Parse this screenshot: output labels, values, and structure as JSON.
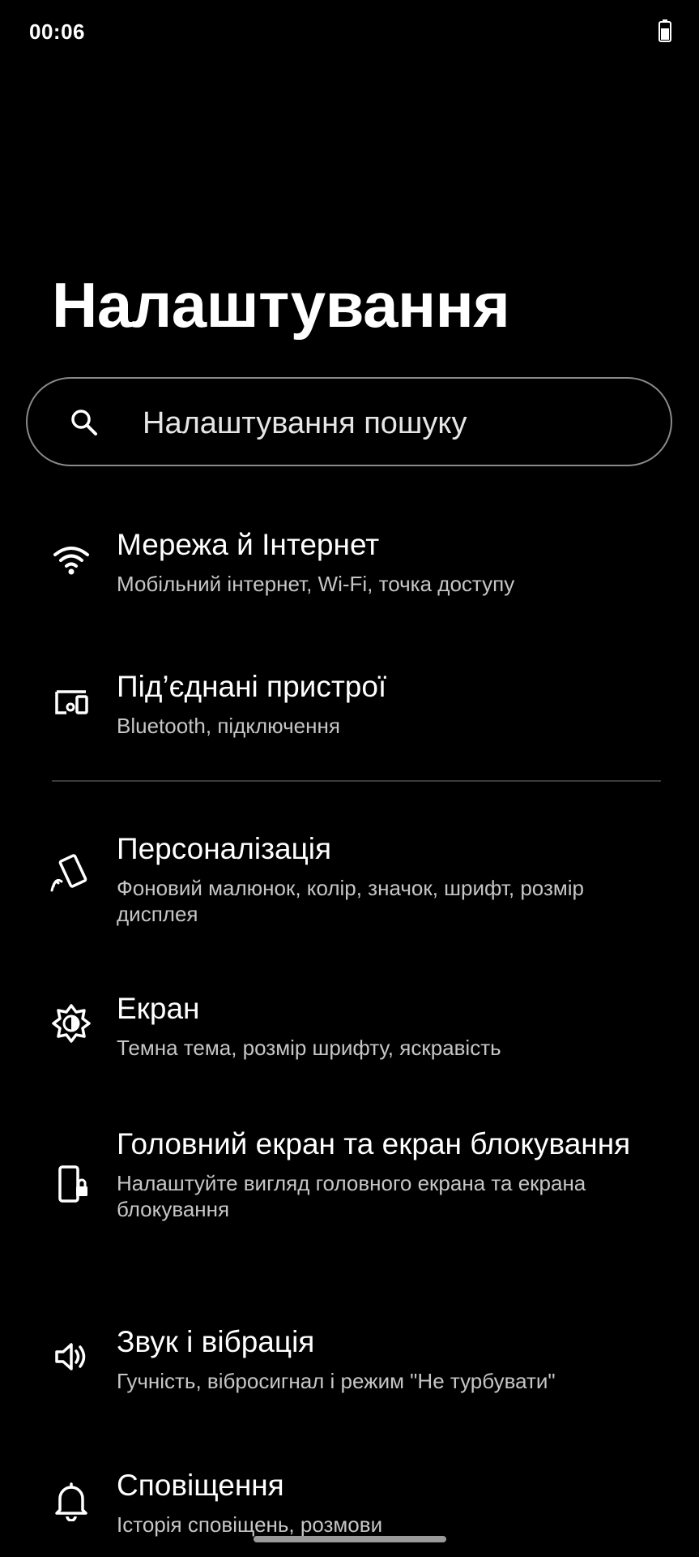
{
  "status_bar": {
    "time": "00:06",
    "battery_icon": "battery-icon"
  },
  "header": {
    "title": "Налаштування"
  },
  "search": {
    "placeholder": "Налаштування пошуку",
    "icon": "search-icon"
  },
  "items": [
    {
      "icon": "wifi-icon",
      "title": "Мережа й Інтернет",
      "subtitle": "Мобільний інтернет, Wi-Fi, точка доступу"
    },
    {
      "icon": "connected-devices-icon",
      "title": "Під’єднані пристрої",
      "subtitle": "Bluetooth, підключення"
    },
    {
      "icon": "personalization-icon",
      "title": "Персоналізація",
      "subtitle": "Фоновий малюнок, колір, значок, шрифт, розмір дисплея"
    },
    {
      "icon": "display-brightness-icon",
      "title": "Екран",
      "subtitle": "Темна тема, розмір шрифту, яскравість"
    },
    {
      "icon": "lock-screen-icon",
      "title": "Головний екран та екран блокування",
      "subtitle": "Налаштуйте вигляд головного екрана та екрана блокування"
    },
    {
      "icon": "sound-icon",
      "title": "Звук і вібрація",
      "subtitle": "Гучність, вібросигнал і режим \"Не турбувати\""
    },
    {
      "icon": "bell-icon",
      "title": "Сповіщення",
      "subtitle": "Історія сповіщень, розмови"
    }
  ]
}
